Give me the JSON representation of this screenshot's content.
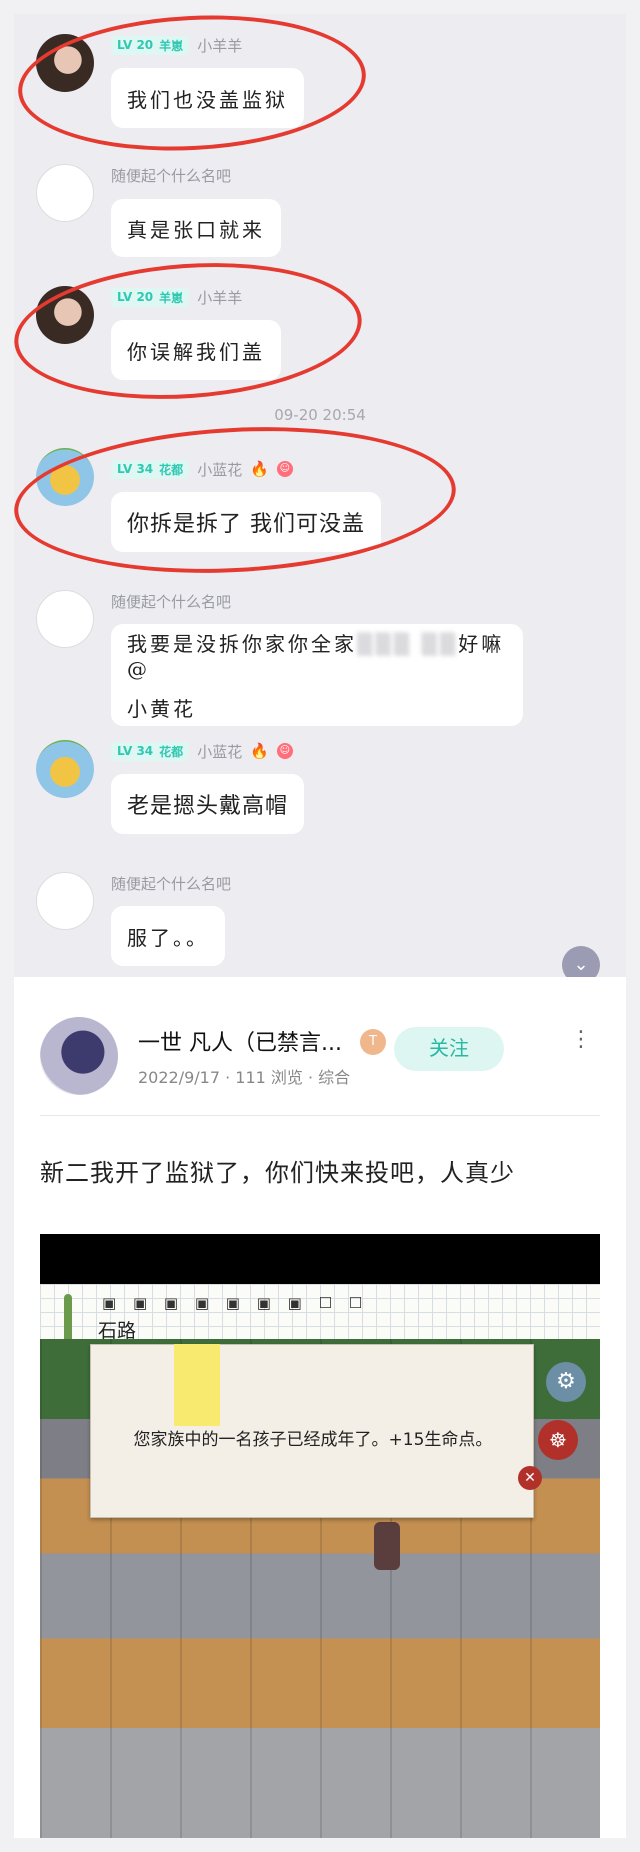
{
  "chat": {
    "messages": [
      {
        "user": "小羊羊",
        "level": "LV 20",
        "badge": "羊崽",
        "text": "我们也没盖监狱"
      },
      {
        "user": "随便起个什么名吧",
        "text": "真是张口就来"
      },
      {
        "user": "小羊羊",
        "level": "LV 20",
        "badge": "羊崽",
        "text": "你误解我们盖"
      },
      {
        "user": "小蓝花",
        "level": "LV 34",
        "badge": "花都",
        "text": "你拆是拆了 我们可没盖"
      },
      {
        "user": "随便起个什么名吧",
        "text_line1": "我要是没拆你家你全家",
        "text_blur": "▒▒▒ ▒▒",
        "text_line1_end": "好嘛@",
        "text_line2": "小黄花"
      },
      {
        "user": "小蓝花",
        "level": "LV 34",
        "badge": "花都",
        "text": "老是摁头戴高帽"
      },
      {
        "user": "随便起个什么名吧",
        "text": "服了。。"
      }
    ],
    "timestamp": "09-20 20:54",
    "scroll_icon": "chevron-down-icon"
  },
  "post": {
    "author": "一世 凡人（已禁言...",
    "vip_badge": "T",
    "meta": "2022/9/17 · 111 浏览 · 综合",
    "follow_label": "关注",
    "more_icon": "⋮",
    "text": "新二我开了监狱了，你们快来投吧，人真少"
  },
  "game": {
    "toolbar_icons": "▣ ▣ ▣ ▣ ▣ ▣ ▣ ☐ ☐",
    "location": "石路",
    "dialog_text": "您家族中的一名孩子已经成年了。+15生命点。",
    "gear_icon": "⚙",
    "wheel_icon": "☸",
    "close_icon": "✕"
  },
  "colors": {
    "accent": "#2fc8b2",
    "annotation_red": "#e53a30",
    "chat_bg": "#ececf1"
  }
}
